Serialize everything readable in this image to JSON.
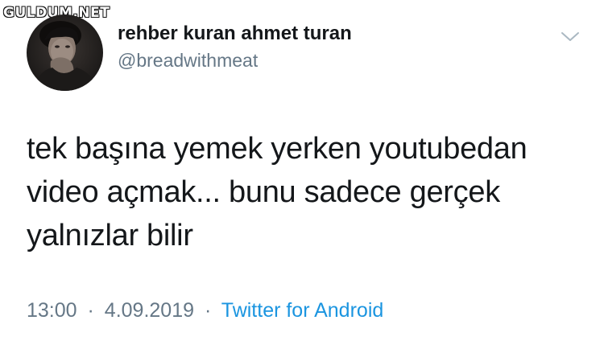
{
  "watermark": "GULDUM.NET",
  "author": {
    "display_name": "rehber kuran ahmet turan",
    "handle": "@breadwithmeat",
    "avatar_icon": "profile-photo"
  },
  "menu_icon": "chevron-down-icon",
  "tweet": {
    "lines": [
      "tek başına yemek yerken youtubedan",
      "video açmak... bunu sadece gerçek",
      "yalnızlar bilir"
    ]
  },
  "meta": {
    "time": "13:00",
    "separator": "·",
    "date": "4.09.2019",
    "source": "Twitter for Android"
  },
  "colors": {
    "text": "#14171a",
    "secondary": "#657786",
    "link": "#1b95e0"
  }
}
